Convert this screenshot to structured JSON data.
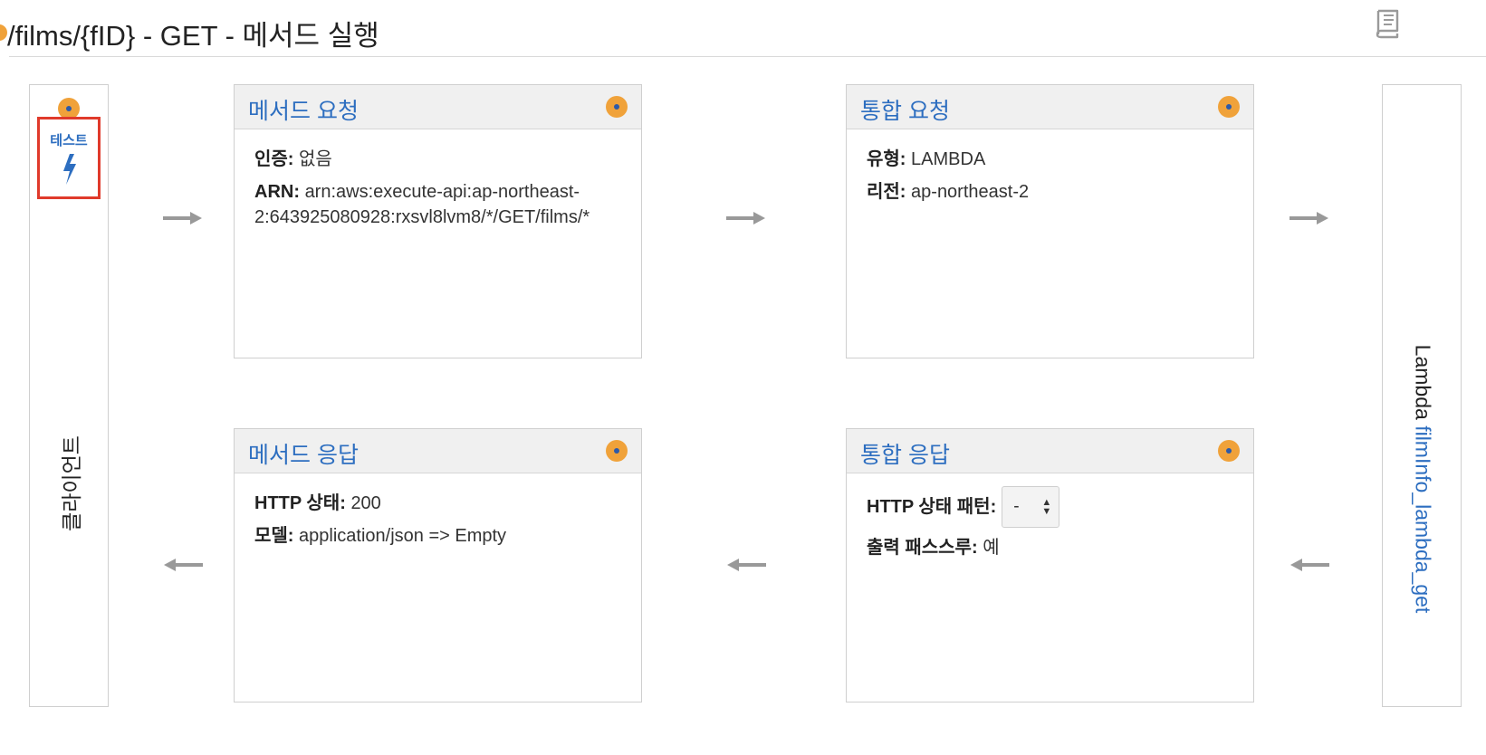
{
  "header": {
    "title": "/films/{fID} - GET - 메서드 실행",
    "help_icon": "book-icon"
  },
  "client": {
    "test_label": "테스트",
    "test_icon": "lightning-bolt-icon",
    "label": "클라이언트"
  },
  "method_request": {
    "title": "메서드 요청",
    "auth_key": "인증:",
    "auth_value": "없음",
    "arn_key": "ARN:",
    "arn_value": "arn:aws:execute-api:ap-northeast-2:643925080928:rxsvl8lvm8/*/GET/films/*"
  },
  "integration_request": {
    "title": "통합 요청",
    "type_key": "유형:",
    "type_value": "LAMBDA",
    "region_key": "리전:",
    "region_value": "ap-northeast-2"
  },
  "method_response": {
    "title": "메서드 응답",
    "status_key": "HTTP 상태:",
    "status_value": "200",
    "model_key": "모델:",
    "model_value": "application/json => Empty"
  },
  "integration_response": {
    "title": "통합 응답",
    "pattern_key": "HTTP 상태 패턴:",
    "pattern_value": "-",
    "passthrough_key": "출력 패스스루:",
    "passthrough_value": "예"
  },
  "lambda": {
    "prefix": "Lambda",
    "function_name": "filmInfo_lambda_get"
  },
  "colors": {
    "accent_orange": "#f0a23a",
    "link_blue": "#2d6ec0",
    "highlight_red": "#e03a2b",
    "arrow_gray": "#999999"
  }
}
